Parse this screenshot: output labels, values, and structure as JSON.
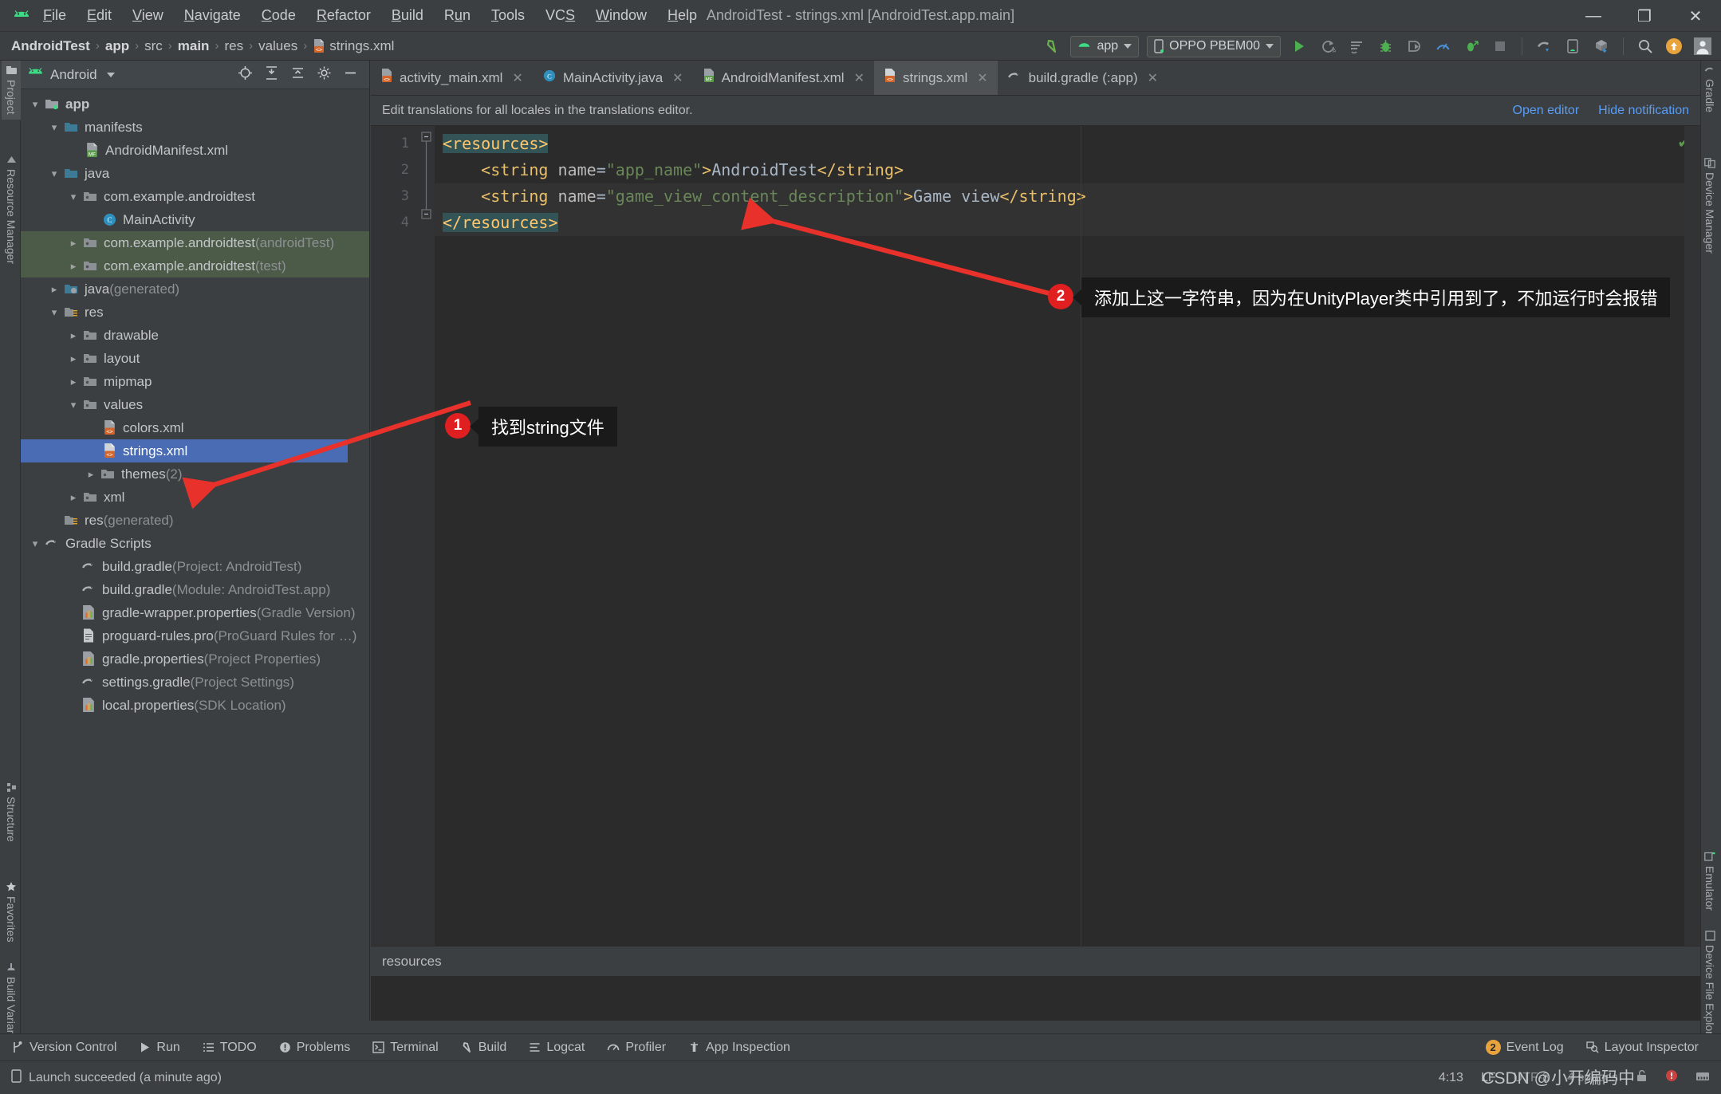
{
  "window": {
    "title": "AndroidTest - strings.xml [AndroidTest.app.main]",
    "minimize": "—",
    "maximize": "❐",
    "close": "✕"
  },
  "menu": {
    "items": [
      {
        "label": "File",
        "mnemonic": "F"
      },
      {
        "label": "Edit",
        "mnemonic": "E"
      },
      {
        "label": "View",
        "mnemonic": "V"
      },
      {
        "label": "Navigate",
        "mnemonic": "N"
      },
      {
        "label": "Code",
        "mnemonic": "C"
      },
      {
        "label": "Refactor",
        "mnemonic": "R"
      },
      {
        "label": "Build",
        "mnemonic": "B"
      },
      {
        "label": "Run",
        "mnemonic": "u"
      },
      {
        "label": "Tools",
        "mnemonic": "T"
      },
      {
        "label": "VCS",
        "mnemonic": "S"
      },
      {
        "label": "Window",
        "mnemonic": "W"
      },
      {
        "label": "Help",
        "mnemonic": "H"
      }
    ]
  },
  "navbar": {
    "crumbs": [
      {
        "label": "AndroidTest",
        "bold": true
      },
      {
        "label": "app",
        "bold": true
      },
      {
        "label": "src",
        "bold": false
      },
      {
        "label": "main",
        "bold": true
      },
      {
        "label": "res",
        "bold": false
      },
      {
        "label": "values",
        "bold": false
      },
      {
        "label": "strings.xml",
        "bold": false,
        "icon": "xml-file-icon"
      }
    ],
    "separator": "›",
    "module_selector": "app",
    "device_selector": "OPPO PBEM00"
  },
  "toolbar_icons": [
    "back-arrow-icon",
    "run-icon",
    "rerun-icon",
    "apply-changes-icon",
    "debug-icon",
    "attach-debugger-icon",
    "profiler-icon",
    "run-with-coverage-icon",
    "stop-icon",
    "gradle-sync-icon",
    "avd-manager-icon",
    "sdk-manager-icon",
    "search-everywhere-icon",
    "update-icon",
    "avatar-icon"
  ],
  "left_strip": [
    {
      "label": "Project",
      "icon": "project-icon",
      "active": true
    },
    {
      "label": "Resource Manager",
      "icon": "resource-manager-icon",
      "active": false
    },
    {
      "label": "Structure",
      "icon": "structure-icon",
      "active": false
    },
    {
      "label": "Favorites",
      "icon": "star-icon",
      "active": false
    },
    {
      "label": "Build Variants",
      "icon": "build-variants-icon",
      "active": false
    }
  ],
  "right_strip": [
    {
      "label": "Gradle",
      "icon": "gradle-elephant-icon"
    },
    {
      "label": "Device Manager",
      "icon": "device-manager-icon"
    },
    {
      "label": "Emulator",
      "icon": "emulator-icon"
    },
    {
      "label": "Device File Explorer",
      "icon": "device-file-explorer-icon"
    }
  ],
  "project_panel": {
    "view_name": "Android",
    "header_icons": [
      "locate-icon",
      "expand-all-icon",
      "collapse-all-icon",
      "settings-gear-icon",
      "hide-icon"
    ],
    "tree": [
      {
        "label": "app",
        "indent": 0,
        "arrow": "down",
        "icon": "module-folder-icon",
        "bold": true
      },
      {
        "label": "manifests",
        "indent": 1,
        "arrow": "down",
        "icon": "folder-icon"
      },
      {
        "label": "AndroidManifest.xml",
        "indent": 2,
        "arrow": "none",
        "icon": "manifest-file-icon"
      },
      {
        "label": "java",
        "indent": 1,
        "arrow": "down",
        "icon": "folder-icon"
      },
      {
        "label": "com.example.androidtest",
        "indent": 2,
        "arrow": "down",
        "icon": "package-icon"
      },
      {
        "label": "MainActivity",
        "indent": 3,
        "arrow": "none",
        "icon": "java-class-icon"
      },
      {
        "label": "com.example.androidtest",
        "suffix": " (androidTest)",
        "indent": 2,
        "arrow": "right",
        "icon": "package-icon",
        "group": "test"
      },
      {
        "label": "com.example.androidtest",
        "suffix": " (test)",
        "indent": 2,
        "arrow": "right",
        "icon": "package-icon",
        "group": "test"
      },
      {
        "label": "java",
        "suffix": " (generated)",
        "indent": 1,
        "arrow": "right",
        "icon": "generated-folder-icon"
      },
      {
        "label": "res",
        "indent": 1,
        "arrow": "down",
        "icon": "res-folder-icon"
      },
      {
        "label": "drawable",
        "indent": 2,
        "arrow": "right",
        "icon": "package-icon"
      },
      {
        "label": "layout",
        "indent": 2,
        "arrow": "right",
        "icon": "package-icon"
      },
      {
        "label": "mipmap",
        "indent": 2,
        "arrow": "right",
        "icon": "package-icon"
      },
      {
        "label": "values",
        "indent": 2,
        "arrow": "down",
        "icon": "package-icon"
      },
      {
        "label": "colors.xml",
        "indent": 3,
        "arrow": "none",
        "icon": "xml-file-icon"
      },
      {
        "label": "strings.xml",
        "indent": 3,
        "arrow": "none",
        "icon": "xml-file-icon",
        "selected": true
      },
      {
        "label": "themes",
        "suffix": " (2)",
        "indent": 3,
        "arrow": "right",
        "icon": "package-icon"
      },
      {
        "label": "xml",
        "indent": 2,
        "arrow": "right",
        "icon": "package-icon"
      },
      {
        "label": "res",
        "suffix": " (generated)",
        "indent": 1,
        "arrow": "none",
        "icon": "res-folder-icon"
      },
      {
        "label": "Gradle Scripts",
        "indent": 0,
        "arrow": "down",
        "icon": "gradle-elephant-icon"
      },
      {
        "label": "build.gradle",
        "suffix": " (Project: AndroidTest)",
        "indent": 1,
        "arrow": "none",
        "icon": "gradle-elephant-icon"
      },
      {
        "label": "build.gradle",
        "suffix": " (Module: AndroidTest.app)",
        "indent": 1,
        "arrow": "none",
        "icon": "gradle-elephant-icon"
      },
      {
        "label": "gradle-wrapper.properties",
        "suffix": " (Gradle Version)",
        "indent": 1,
        "arrow": "none",
        "icon": "properties-file-icon"
      },
      {
        "label": "proguard-rules.pro",
        "suffix": " (ProGuard Rules for …)",
        "indent": 1,
        "arrow": "none",
        "icon": "text-file-icon"
      },
      {
        "label": "gradle.properties",
        "suffix": " (Project Properties)",
        "indent": 1,
        "arrow": "none",
        "icon": "properties-file-icon"
      },
      {
        "label": "settings.gradle",
        "suffix": " (Project Settings)",
        "indent": 1,
        "arrow": "none",
        "icon": "gradle-elephant-icon"
      },
      {
        "label": "local.properties",
        "suffix": " (SDK Location)",
        "indent": 1,
        "arrow": "none",
        "icon": "properties-file-icon"
      }
    ]
  },
  "editor": {
    "tabs": [
      {
        "label": "activity_main.xml",
        "icon": "xml-file-icon",
        "active": false
      },
      {
        "label": "MainActivity.java",
        "icon": "java-class-icon",
        "active": false
      },
      {
        "label": "AndroidManifest.xml",
        "icon": "manifest-file-icon",
        "active": false
      },
      {
        "label": "strings.xml",
        "icon": "xml-file-icon",
        "active": true
      },
      {
        "label": "build.gradle (:app)",
        "icon": "gradle-elephant-icon",
        "active": false
      }
    ],
    "tab_close": "✕",
    "notification": {
      "message": "Edit translations for all locales in the translations editor.",
      "open_editor": "Open editor",
      "hide_notification": "Hide notification"
    },
    "line_numbers": [
      "1",
      "2",
      "3",
      "4"
    ],
    "code_lines": [
      {
        "indent": 0,
        "segments": [
          {
            "t": "<resources>",
            "c": "tagfold"
          }
        ]
      },
      {
        "indent": 1,
        "segments": [
          {
            "t": "<string",
            "c": "tag"
          },
          {
            "t": " name",
            "c": "attrname"
          },
          {
            "t": "=",
            "c": "text"
          },
          {
            "t": "\"app_name\"",
            "c": "attrval"
          },
          {
            "t": ">",
            "c": "tag"
          },
          {
            "t": "AndroidTest",
            "c": "text"
          },
          {
            "t": "</string>",
            "c": "tag"
          }
        ]
      },
      {
        "indent": 1,
        "segments": [
          {
            "t": "<string",
            "c": "tag"
          },
          {
            "t": " name",
            "c": "attrname"
          },
          {
            "t": "=",
            "c": "text"
          },
          {
            "t": "\"game_view_content_description\"",
            "c": "attrval"
          },
          {
            "t": ">",
            "c": "tag"
          },
          {
            "t": "Game view",
            "c": "text"
          },
          {
            "t": "</string>",
            "c": "tag"
          }
        ]
      },
      {
        "indent": 0,
        "segments": [
          {
            "t": "</resources>",
            "c": "tagfold"
          }
        ]
      }
    ],
    "breadcrumb_bottom": "resources",
    "inspection_status": "✔"
  },
  "annotations": [
    {
      "number": "1",
      "text": "找到string文件"
    },
    {
      "number": "2",
      "text": "添加上这一字符串，因为在UnityPlayer类中引用到了，不加运行时会报错"
    }
  ],
  "toolwindow_bar": {
    "items": [
      {
        "label": "Version Control",
        "icon": "version-control-icon"
      },
      {
        "label": "Run",
        "icon": "run-icon"
      },
      {
        "label": "TODO",
        "icon": "todo-icon"
      },
      {
        "label": "Problems",
        "icon": "problems-icon"
      },
      {
        "label": "Terminal",
        "icon": "terminal-icon"
      },
      {
        "label": "Build",
        "icon": "build-hammer-icon"
      },
      {
        "label": "Logcat",
        "icon": "logcat-icon"
      },
      {
        "label": "Profiler",
        "icon": "profiler-icon"
      },
      {
        "label": "App Inspection",
        "icon": "app-inspection-icon"
      }
    ],
    "event_log": {
      "label": "Event Log",
      "count": "2"
    },
    "layout_inspector": {
      "label": "Layout Inspector",
      "icon": "layout-inspector-icon"
    }
  },
  "statusbar": {
    "message": "Launch succeeded (a minute ago)",
    "message_icon": "device-icon",
    "caret_position": "4:13",
    "line_separator": "LF",
    "encoding": "UTF-8",
    "indent": "4 spaces",
    "lock_icon": "unlocked-icon",
    "notification_icon": "notification-bell-icon",
    "memory_icon": "memory-indicator-icon"
  },
  "watermark": "CSDN @小开编码中",
  "colors": {
    "background": "#3c3f41",
    "editor_background": "#2b2b2b",
    "selection_blue": "#4a6cb5",
    "annotation_red": "#e02020",
    "link_blue": "#589df6",
    "android_green": "#3ddc84",
    "test_group_green": "#4c5b48"
  }
}
